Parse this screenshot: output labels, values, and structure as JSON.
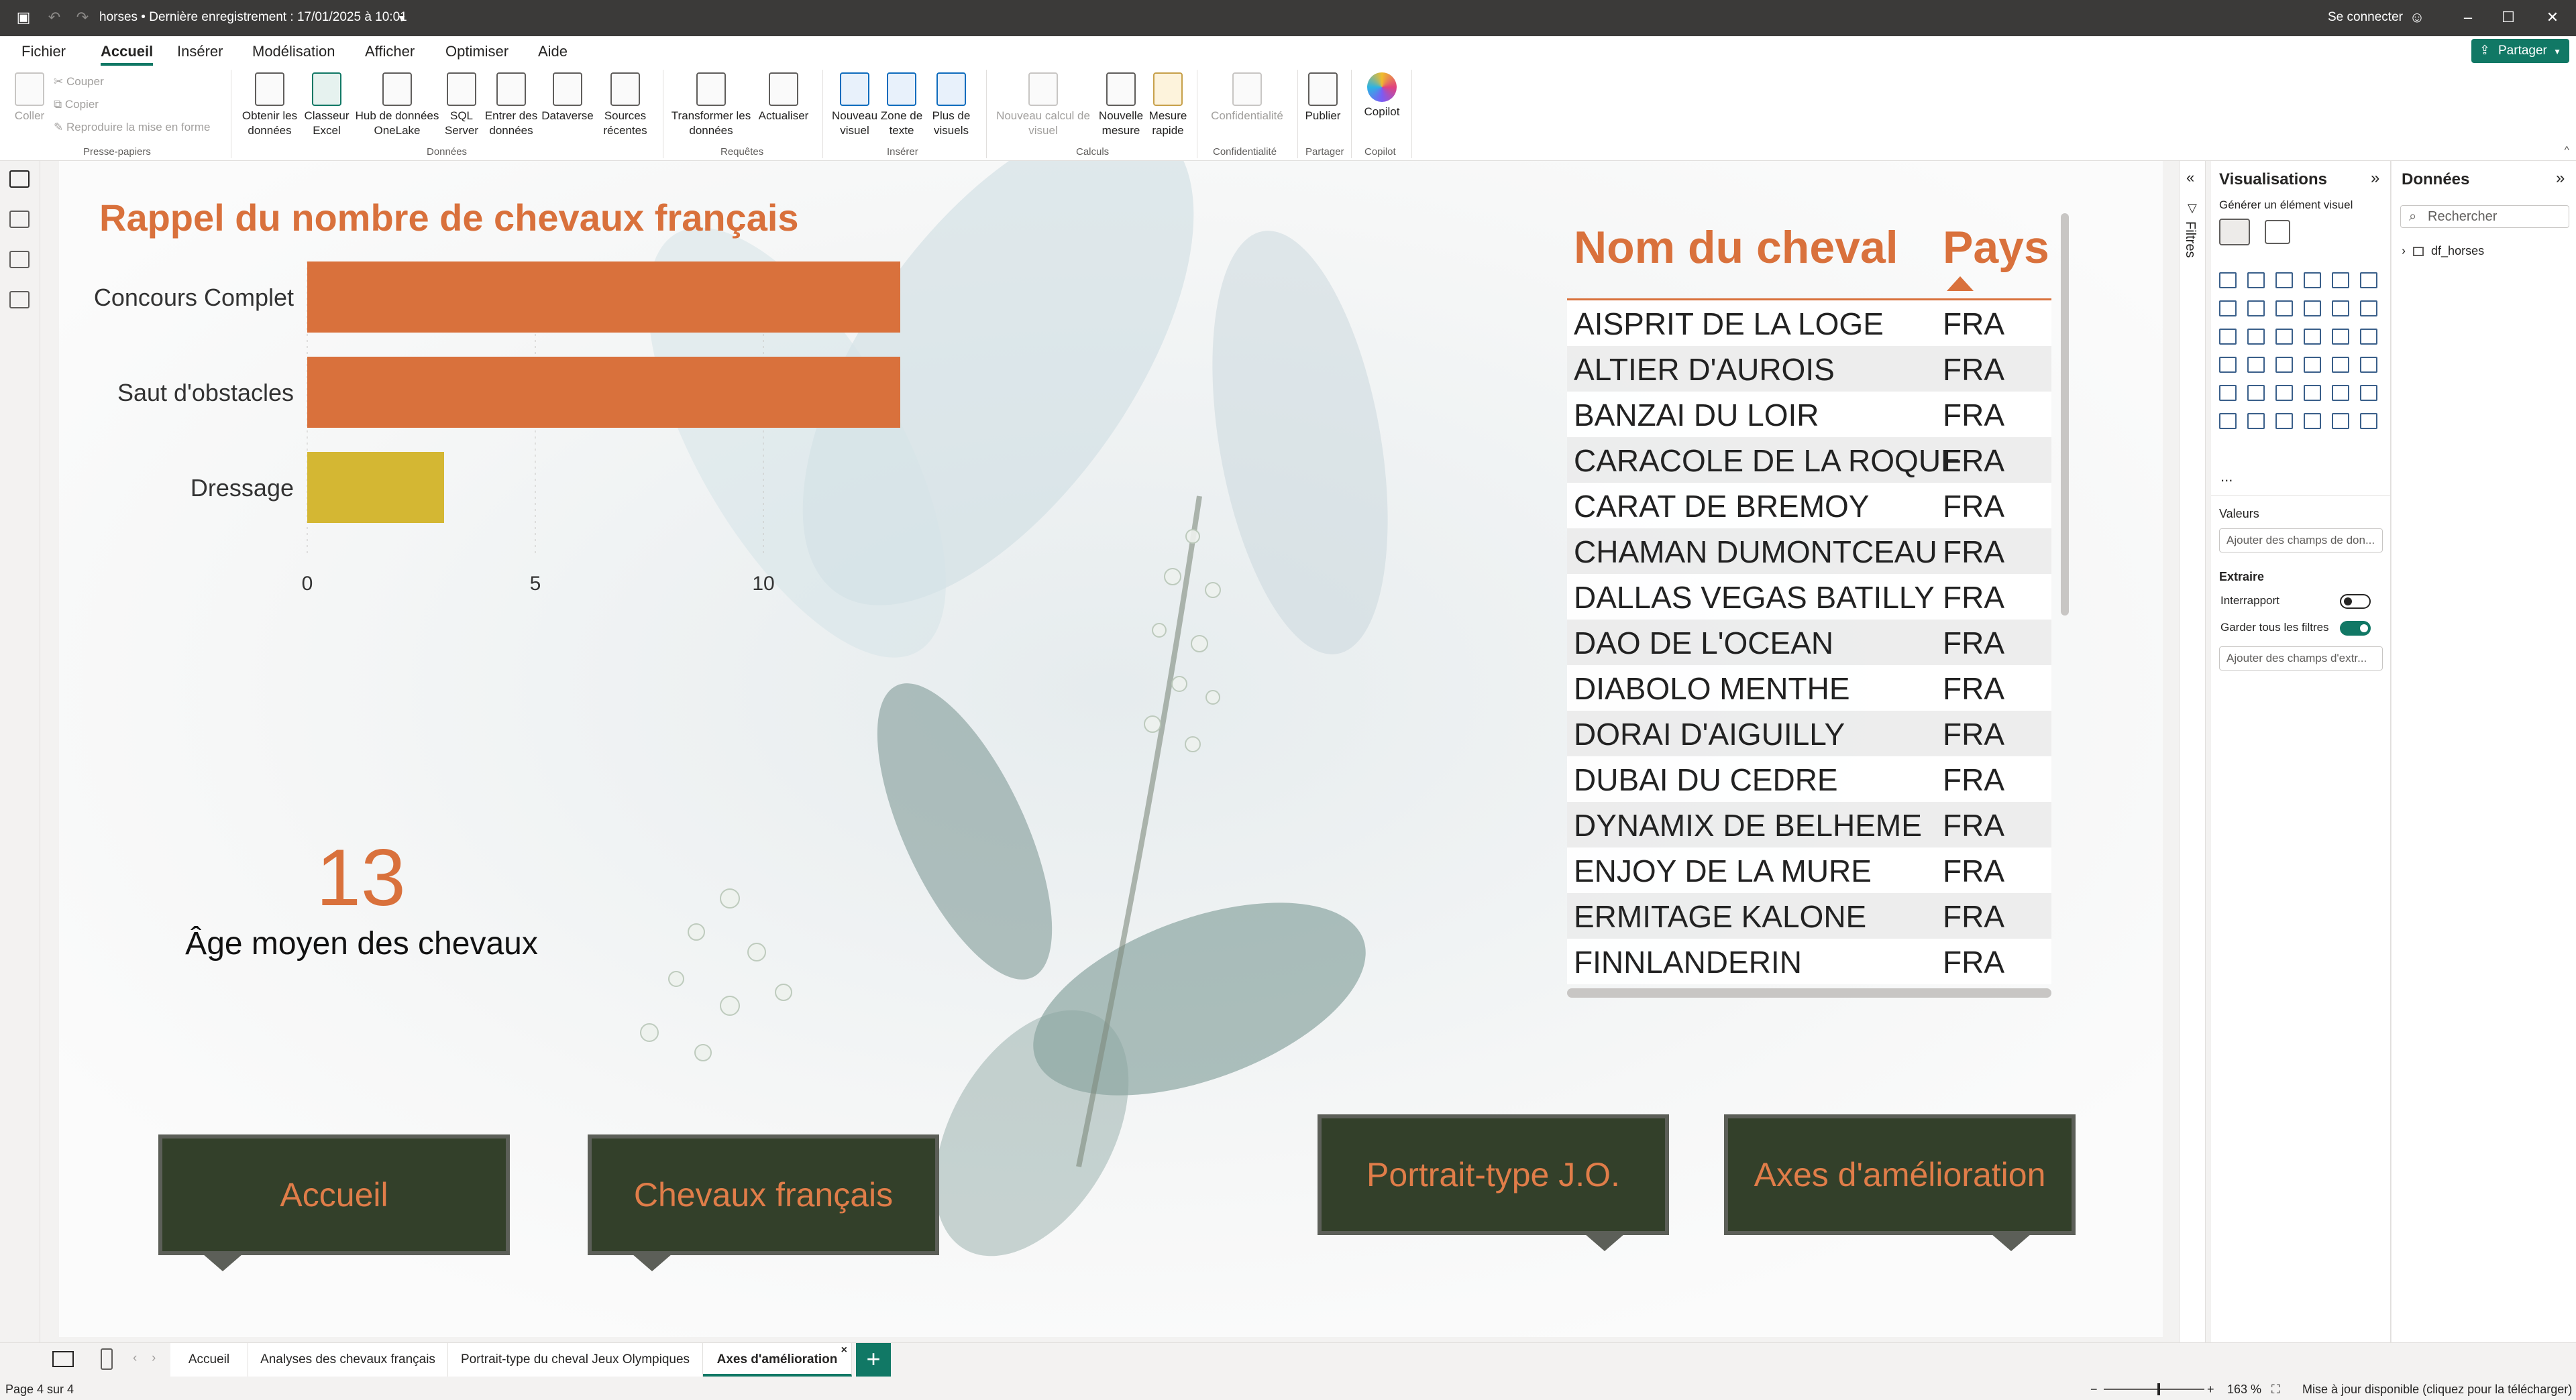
{
  "titlebar": {
    "doc_title": "horses • Dernière enregistrement : 17/01/2025 à 10:01",
    "sign_in": "Se connecter"
  },
  "menu": {
    "items": [
      "Fichier",
      "Accueil",
      "Insérer",
      "Modélisation",
      "Afficher",
      "Optimiser",
      "Aide"
    ],
    "active": "Accueil",
    "share": "Partager"
  },
  "ribbon": {
    "clipboard": {
      "paste": "Coller",
      "cut": "Couper",
      "copy": "Copier",
      "format_painter": "Reproduire la mise en forme",
      "group": "Presse-papiers"
    },
    "data": {
      "get_data": "Obtenir les données",
      "excel": "Classeur Excel",
      "onelake": "Hub de données OneLake",
      "sql": "SQL Server",
      "enter": "Entrer des données",
      "dataverse": "Dataverse",
      "recent": "Sources récentes",
      "group": "Données"
    },
    "queries": {
      "transform": "Transformer les données",
      "refresh": "Actualiser",
      "group": "Requêtes"
    },
    "insert": {
      "new_visual": "Nouveau visuel",
      "text_box": "Zone de texte",
      "more_visuals": "Plus de visuels",
      "group": "Insérer"
    },
    "calc": {
      "new_visual_calc": "Nouveau calcul de visuel",
      "new_measure": "Nouvelle mesure",
      "quick_measure": "Mesure rapide",
      "group": "Calculs"
    },
    "sensitivity": {
      "label": "Confidentialité",
      "group": "Confidentialité"
    },
    "share": {
      "publish": "Publier",
      "group": "Partager"
    },
    "copilot": {
      "label": "Copilot",
      "group": "Copilot"
    }
  },
  "report": {
    "kpi": {
      "value": "13",
      "label": "Âge moyen des chevaux"
    },
    "table": {
      "headers": [
        "Nom du cheval",
        "Pays"
      ],
      "rows": [
        [
          "AISPRIT DE LA LOGE",
          "FRA"
        ],
        [
          "ALTIER D'AUROIS",
          "FRA"
        ],
        [
          "BANZAI DU LOIR",
          "FRA"
        ],
        [
          "CARACOLE DE LA ROQUE",
          "FRA"
        ],
        [
          "CARAT DE BREMOY",
          "FRA"
        ],
        [
          "CHAMAN DUMONTCEAU",
          "FRA"
        ],
        [
          "DALLAS VEGAS BATILLY",
          "FRA"
        ],
        [
          "DAO DE L'OCEAN",
          "FRA"
        ],
        [
          "DIABOLO MENTHE",
          "FRA"
        ],
        [
          "DORAI D'AIGUILLY",
          "FRA"
        ],
        [
          "DUBAI DU CEDRE",
          "FRA"
        ],
        [
          "DYNAMIX DE BELHEME",
          "FRA"
        ],
        [
          "ENJOY DE LA MURE",
          "FRA"
        ],
        [
          "ERMITAGE KALONE",
          "FRA"
        ],
        [
          "FINNLANDERIN",
          "FRA"
        ]
      ]
    },
    "nav_buttons": [
      "Accueil",
      "Chevaux français",
      "Portrait-type J.O.",
      "Axes d'amélioration"
    ]
  },
  "chart_data": {
    "type": "bar",
    "orientation": "horizontal",
    "title": "Rappel du nombre de chevaux français",
    "categories": [
      "Concours Complet",
      "Saut d'obstacles",
      "Dressage"
    ],
    "values": [
      13,
      13,
      3
    ],
    "colors": [
      "#d9713c",
      "#d9713c",
      "#d4b733"
    ],
    "xticks": [
      0,
      5,
      10
    ],
    "xlim": [
      0,
      13
    ],
    "grid": true
  },
  "panes": {
    "filters": "Filtres",
    "visualizations": {
      "title": "Visualisations",
      "build": "Générer un élément visuel",
      "values": "Valeurs",
      "values_well": "Ajouter des champs de don...",
      "drillthrough": "Extraire",
      "cross_report": "Interrapport",
      "keep_filters": "Garder tous les filtres",
      "drill_well": "Ajouter des champs d'extr...",
      "more": "..."
    },
    "data": {
      "title": "Données",
      "search_placeholder": "Rechercher",
      "table": "df_horses"
    }
  },
  "tabs": {
    "items": [
      "Accueil",
      "Analyses des chevaux français",
      "Portrait-type du cheval Jeux Olympiques",
      "Axes d'amélioration"
    ],
    "active": "Axes d'amélioration",
    "add": "+"
  },
  "status": {
    "page": "Page 4 sur 4",
    "zoom": "163 %",
    "update": "Mise à jour disponible (cliquez pour la télécharger)"
  },
  "colors": {
    "accent": "#117865",
    "orange": "#d9713c",
    "yellow": "#d4b733",
    "button_bg": "#33402a"
  }
}
